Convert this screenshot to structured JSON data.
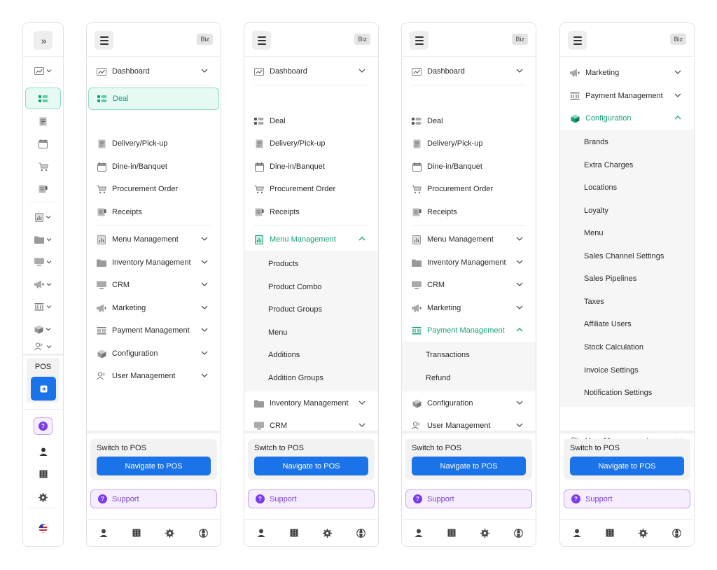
{
  "biz_label": "Biz",
  "nav": {
    "dashboard": "Dashboard",
    "deal": "Deal",
    "delivery": "Delivery/Pick-up",
    "dine_in": "Dine-in/Banquet",
    "procurement": "Procurement Order",
    "receipts": "Receipts",
    "menu_management": "Menu Management",
    "inventory_management": "Inventory Management",
    "crm": "CRM",
    "marketing": "Marketing",
    "payment_management": "Payment Management",
    "configuration": "Configuration",
    "user_management": "User Management"
  },
  "menu_management_items": [
    "Products",
    "Product Combo",
    "Product Groups",
    "Menu",
    "Additions",
    "Addition Groups"
  ],
  "payment_management_items": [
    "Transactions",
    "Refund"
  ],
  "configuration_items": [
    "Brands",
    "Extra Charges",
    "Locations",
    "Loyalty",
    "Menu",
    "Sales Channel Settings",
    "Sales Pipelines",
    "Taxes",
    "Affiliate Users",
    "Stock Calculation",
    "Invoice Settings",
    "Notification Settings"
  ],
  "footer": {
    "switch_label": "Switch to POS",
    "navigate_button": "Navigate to POS",
    "support_label": "Support",
    "pos_label": "POS"
  },
  "colors": {
    "accent_green": "#15a06d",
    "primary_blue": "#1a73e8",
    "support_purple": "#7c3aed"
  }
}
